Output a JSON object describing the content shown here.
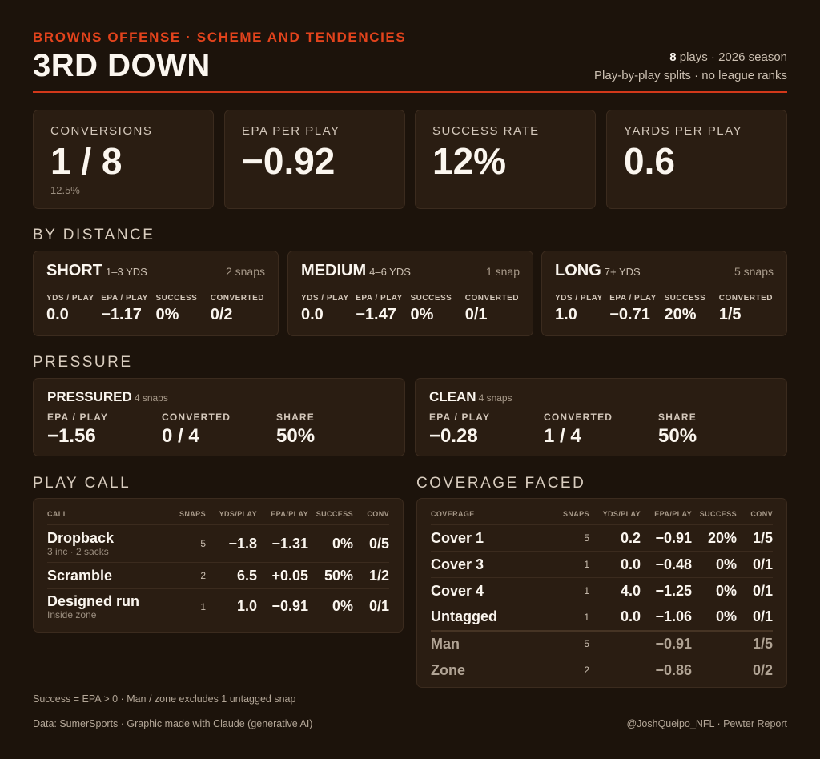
{
  "header": {
    "kicker": "BROWNS OFFENSE · SCHEME AND TENDENCIES",
    "title": "3RD DOWN",
    "plays_count": "8",
    "plays_suffix": " plays · 2026 season",
    "note": "Play-by-play splits · no league ranks"
  },
  "kpis": [
    {
      "label": "CONVERSIONS",
      "value": "1 / 8",
      "sub": "12.5%"
    },
    {
      "label": "EPA PER PLAY",
      "value": "−0.92",
      "sub": ""
    },
    {
      "label": "SUCCESS RATE",
      "value": "12%",
      "sub": ""
    },
    {
      "label": "YARDS PER PLAY",
      "value": "0.6",
      "sub": ""
    }
  ],
  "by_distance": {
    "heading": "BY DISTANCE",
    "stat_labels": [
      "YDS / PLAY",
      "EPA / PLAY",
      "SUCCESS",
      "CONVERTED"
    ],
    "groups": [
      {
        "name": "SHORT",
        "range": "1–3 YDS",
        "snaps": "2 snaps",
        "ypp": "0.0",
        "epa": "−1.17",
        "success": "0%",
        "converted": "0/2"
      },
      {
        "name": "MEDIUM",
        "range": "4–6 YDS",
        "snaps": "1 snap",
        "ypp": "0.0",
        "epa": "−1.47",
        "success": "0%",
        "converted": "0/1"
      },
      {
        "name": "LONG",
        "range": "7+ YDS",
        "snaps": "5 snaps",
        "ypp": "1.0",
        "epa": "−0.71",
        "success": "20%",
        "converted": "1/5"
      }
    ]
  },
  "pressure": {
    "heading": "PRESSURE",
    "stat_labels": [
      "EPA / PLAY",
      "CONVERTED",
      "SHARE"
    ],
    "groups": [
      {
        "name": "PRESSURED",
        "snaps": "4 snaps",
        "epa": "−1.56",
        "converted": "0 / 4",
        "share": "50%"
      },
      {
        "name": "CLEAN",
        "snaps": "4 snaps",
        "epa": "−0.28",
        "converted": "1 / 4",
        "share": "50%"
      }
    ]
  },
  "play_call": {
    "heading": "PLAY CALL",
    "columns": [
      "CALL",
      "SNAPS",
      "YDS/PLAY",
      "EPA/PLAY",
      "SUCCESS",
      "CONV"
    ],
    "rows": [
      {
        "name": "Dropback",
        "sub": "3 inc · 2 sacks",
        "snaps": "5",
        "ypp": "−1.8",
        "epa": "−1.31",
        "success": "0%",
        "conv": "0/5"
      },
      {
        "name": "Scramble",
        "sub": "",
        "snaps": "2",
        "ypp": "6.5",
        "epa": "+0.05",
        "success": "50%",
        "conv": "1/2"
      },
      {
        "name": "Designed run",
        "sub": "Inside zone",
        "snaps": "1",
        "ypp": "1.0",
        "epa": "−0.91",
        "success": "0%",
        "conv": "0/1"
      }
    ]
  },
  "coverage": {
    "heading": "COVERAGE FACED",
    "columns": [
      "COVERAGE",
      "SNAPS",
      "YDS/PLAY",
      "EPA/PLAY",
      "SUCCESS",
      "CONV"
    ],
    "rows": [
      {
        "name": "Cover 1",
        "snaps": "5",
        "ypp": "0.2",
        "epa": "−0.91",
        "success": "20%",
        "conv": "1/5"
      },
      {
        "name": "Cover 3",
        "snaps": "1",
        "ypp": "0.0",
        "epa": "−0.48",
        "success": "0%",
        "conv": "0/1"
      },
      {
        "name": "Cover 4",
        "snaps": "1",
        "ypp": "4.0",
        "epa": "−1.25",
        "success": "0%",
        "conv": "0/1"
      },
      {
        "name": "Untagged",
        "snaps": "1",
        "ypp": "0.0",
        "epa": "−1.06",
        "success": "0%",
        "conv": "0/1"
      },
      {
        "name": "Man",
        "snaps": "5",
        "ypp": "",
        "epa": "−0.91",
        "success": "",
        "conv": "1/5"
      },
      {
        "name": "Zone",
        "snaps": "2",
        "ypp": "",
        "epa": "−0.86",
        "success": "",
        "conv": "0/2"
      }
    ]
  },
  "footer": {
    "note": "Success = EPA > 0 · Man / zone excludes 1 untagged snap",
    "source": "Data: SumerSports · Graphic made with Claude (generative AI)",
    "credit": "@JoshQueipo_NFL · Pewter Report"
  },
  "colors": {
    "accent": "#e2431c",
    "background": "#1c130b",
    "card": "#2a1d12"
  }
}
